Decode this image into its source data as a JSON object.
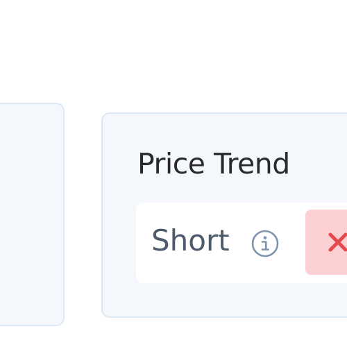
{
  "cards": {
    "price_trend": {
      "title": "Price Trend",
      "trend": {
        "label": "Short",
        "info_icon": "info-icon",
        "status_icon": "close-icon",
        "status_color": "#e5484d",
        "status_background": "#fcd0d2"
      }
    }
  },
  "colors": {
    "card_background": "#f4f8fd",
    "card_border": "#dce8f6",
    "title_text": "#2a2a2a",
    "label_text": "#4c5a6b"
  }
}
